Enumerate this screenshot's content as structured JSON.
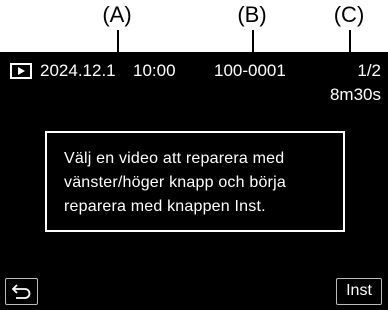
{
  "callouts": {
    "a": "(A)",
    "b": "(B)",
    "c": "(C)"
  },
  "status_bar": {
    "play_icon": "playback-mode-icon",
    "date": "2024.12.1",
    "time": "10:00",
    "file_number": "100-0001",
    "count": "1/2",
    "duration": "8m30s"
  },
  "message": {
    "line1": "Välj en video att reparera med",
    "line2": "vänster/höger knapp och börja",
    "line3": "reparera med knappen Inst."
  },
  "buttons": {
    "back_icon": "return-arrow-icon",
    "inst_label": "Inst"
  },
  "colors": {
    "screen_background": "#000000",
    "text": "#ffffff",
    "button_border": "#bbbbbb"
  }
}
